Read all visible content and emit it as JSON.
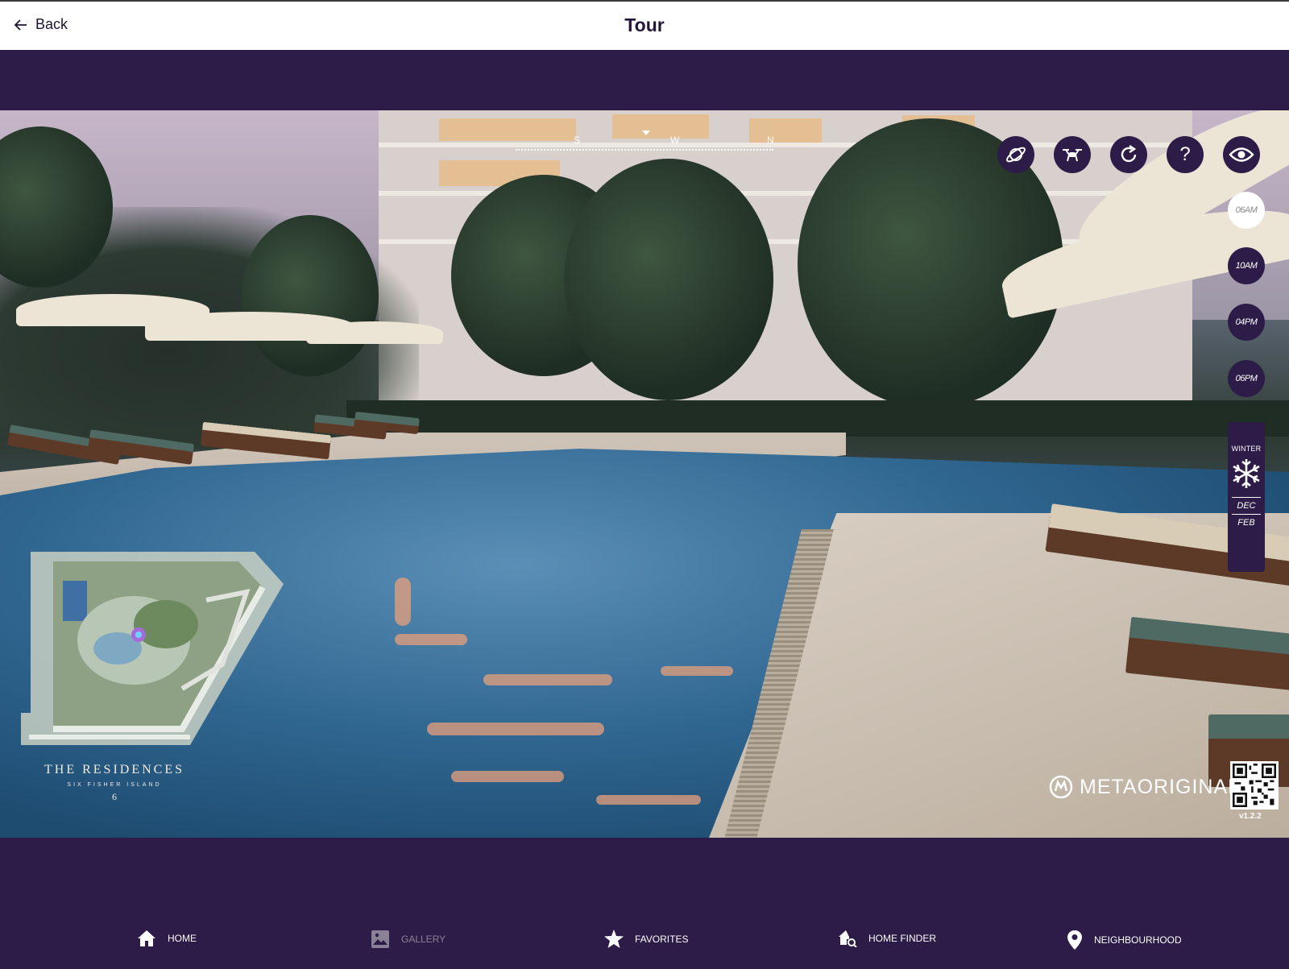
{
  "header": {
    "back_label": "Back",
    "title": "Tour"
  },
  "compass": {
    "south": "S",
    "west": "W",
    "north": "N"
  },
  "controls": [
    {
      "name": "planet-icon"
    },
    {
      "name": "drone-icon"
    },
    {
      "name": "rotate-icon"
    },
    {
      "name": "help-icon",
      "glyph": "?"
    },
    {
      "name": "eye-icon"
    }
  ],
  "times": [
    {
      "label": "06AM",
      "active": true
    },
    {
      "label": "10AM",
      "active": false
    },
    {
      "label": "04PM",
      "active": false
    },
    {
      "label": "06PM",
      "active": false
    }
  ],
  "season": {
    "label": "WINTER",
    "icon": "snowflake-icon",
    "from": "DEC",
    "to": "FEB"
  },
  "brand": {
    "name": "THE RESIDENCES",
    "subtitle": "SIX FISHER ISLAND",
    "seal": "6"
  },
  "watermark": {
    "text": "METAORIGINAL",
    "version": "v1.2.2"
  },
  "nav": [
    {
      "label": "HOME",
      "icon": "home-icon",
      "enabled": true
    },
    {
      "label": "GALLERY",
      "icon": "gallery-icon",
      "enabled": false
    },
    {
      "label": "FAVORITES",
      "icon": "star-icon",
      "enabled": true
    },
    {
      "label": "HOME FINDER",
      "icon": "home-finder-icon",
      "enabled": true
    },
    {
      "label": "NEIGHBOURHOOD",
      "icon": "location-pin-icon",
      "enabled": true
    }
  ],
  "colors": {
    "brand_purple": "#2c1c47",
    "header_bg": "#ffffff",
    "nav_text": "#ffffff",
    "nav_disabled": "#8b8196"
  }
}
